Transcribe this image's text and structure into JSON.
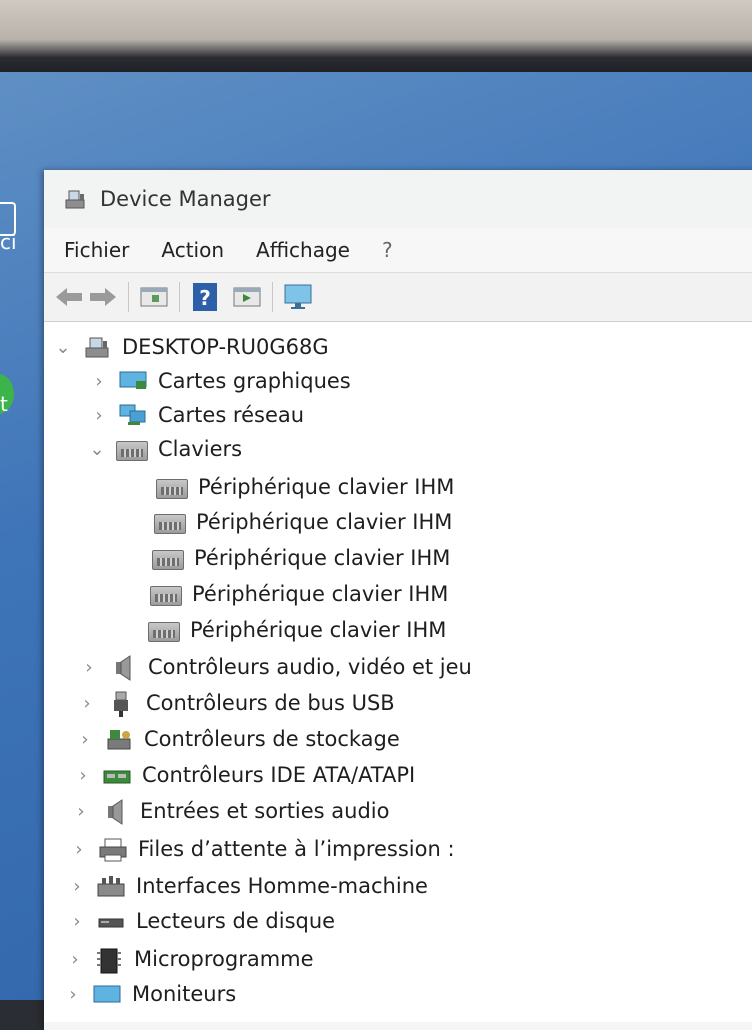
{
  "desktop": {
    "edge_text_1": "ci",
    "edge_text_2": "t"
  },
  "window": {
    "title": "Device Manager"
  },
  "menu": {
    "items": [
      "Fichier",
      "Action",
      "Affichage",
      "?"
    ]
  },
  "toolbar": {
    "buttons": [
      "back-arrow-icon",
      "forward-arrow-icon",
      "show-hide-tree-icon",
      "help-icon",
      "properties-icon",
      "display-monitor-icon"
    ]
  },
  "tree": {
    "root": "DESKTOP-RU0G68G",
    "nodes": {
      "cartes_graphiques": "Cartes graphiques",
      "cartes_reseau": "Cartes réseau",
      "claviers": "Claviers",
      "clavier_1": "Périphérique clavier IHM",
      "clavier_2": "Périphérique clavier IHM",
      "clavier_3": "Périphérique clavier IHM",
      "clavier_4": "Périphérique clavier IHM",
      "clavier_5": "Périphérique clavier IHM",
      "controleurs_audio": "Contrôleurs audio, vidéo et jeu",
      "controleurs_usb": "Contrôleurs de bus USB",
      "controleurs_stockage": "Contrôleurs de stockage",
      "controleurs_ide": "Contrôleurs IDE ATA/ATAPI",
      "entrees_sorties_audio": "Entrées et sorties audio",
      "files_impression": "Files d’attente à l’impression :",
      "interfaces_hm": "Interfaces Homme-machine",
      "lecteurs_disque": "Lecteurs de disque",
      "microprogramme": "Microprogramme",
      "moniteurs": "Moniteurs"
    }
  }
}
